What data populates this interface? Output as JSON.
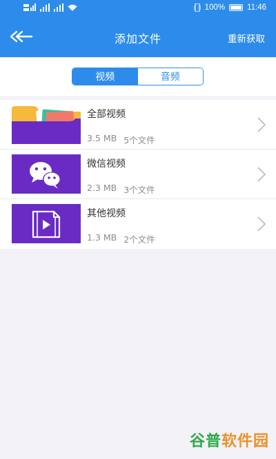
{
  "status_bar": {
    "battery": "100%",
    "time": "11:46"
  },
  "app_bar": {
    "title": "添加文件",
    "right_action": "重新获取"
  },
  "tabs": [
    {
      "label": "视频",
      "active": true
    },
    {
      "label": "音频",
      "active": false
    }
  ],
  "folders": [
    {
      "name": "全部视频",
      "size": "3.5 MB",
      "count": "5个文件",
      "icon": "folder-icon"
    },
    {
      "name": "微信视频",
      "size": "2.3 MB",
      "count": "3个文件",
      "icon": "wechat-icon"
    },
    {
      "name": "其他视频",
      "size": "1.3 MB",
      "count": "2个文件",
      "icon": "video-file-icon"
    }
  ],
  "watermark": {
    "part1": "谷普",
    "part2": "软件园"
  },
  "colors": {
    "accent": "#2d8ceb",
    "thumb_purple": "#6a2bc4",
    "background": "#f3f3f7"
  }
}
